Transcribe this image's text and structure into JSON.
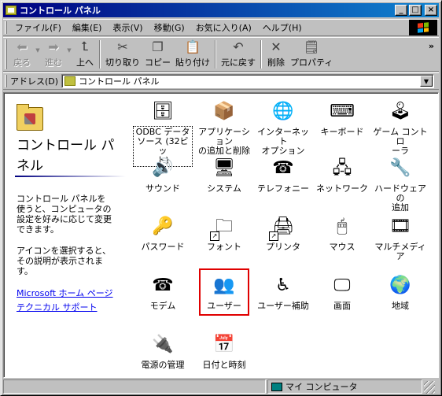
{
  "window": {
    "title": "コントロール パネル"
  },
  "titlebar_buttons": {
    "minimize": "_",
    "maximize": "□",
    "close": "×"
  },
  "menu": [
    "ファイル(F)",
    "編集(E)",
    "表示(V)",
    "移動(G)",
    "お気に入り(A)",
    "ヘルプ(H)"
  ],
  "toolbar": {
    "back": "戻る",
    "forward": "進む",
    "up": "上へ",
    "cut": "切り取り",
    "copy": "コピー",
    "paste": "貼り付け",
    "undo": "元に戻す",
    "delete": "削除",
    "properties": "プロパティ",
    "more": "»"
  },
  "address": {
    "label": "アドレス(D)",
    "value": "コントロール パネル"
  },
  "leftpane": {
    "title": "コントロール パネル",
    "description": "コントロール パネルを使うと、コンピュータの設定を好みに応じて変更できます。",
    "hint": "アイコンを選択すると、その説明が表示されます。",
    "links": [
      "Microsoft ホーム ページ",
      "テクニカル サポート"
    ]
  },
  "items": [
    {
      "label": "ODBC データ\nソース (32ビッ\nト)",
      "icon": "odbc-icon",
      "symbol": "🗄"
    },
    {
      "label": "アプリケーション\nの追加と削除",
      "icon": "add-remove-programs-icon",
      "symbol": "📦"
    },
    {
      "label": "インターネット\nオプション",
      "icon": "internet-options-icon",
      "symbol": "🌐"
    },
    {
      "label": "キーボード",
      "icon": "keyboard-icon",
      "symbol": "⌨"
    },
    {
      "label": "ゲーム コントロ\nーラ",
      "icon": "game-controller-icon",
      "symbol": "🕹"
    },
    {
      "label": "サウンド",
      "icon": "sound-icon",
      "symbol": "🔊"
    },
    {
      "label": "システム",
      "icon": "system-icon",
      "symbol": "🖥"
    },
    {
      "label": "テレフォニー",
      "icon": "telephony-icon",
      "symbol": "☎"
    },
    {
      "label": "ネットワーク",
      "icon": "network-icon",
      "symbol": "🖧"
    },
    {
      "label": "ハードウェアの\n追加",
      "icon": "add-hardware-icon",
      "symbol": "🔧"
    },
    {
      "label": "パスワード",
      "icon": "passwords-icon",
      "symbol": "🔑"
    },
    {
      "label": "フォント",
      "icon": "fonts-folder-icon",
      "symbol": "🗀"
    },
    {
      "label": "プリンタ",
      "icon": "printers-folder-icon",
      "symbol": "🖨"
    },
    {
      "label": "マウス",
      "icon": "mouse-icon",
      "symbol": "🖱"
    },
    {
      "label": "マルチメディア",
      "icon": "multimedia-icon",
      "symbol": "🎞"
    },
    {
      "label": "モデム",
      "icon": "modem-icon",
      "symbol": "☎"
    },
    {
      "label": "ユーザー",
      "icon": "users-icon",
      "symbol": "👥"
    },
    {
      "label": "ユーザー補助",
      "icon": "accessibility-icon",
      "symbol": "♿"
    },
    {
      "label": "画面",
      "icon": "display-icon",
      "symbol": "🖵"
    },
    {
      "label": "地域",
      "icon": "regional-settings-icon",
      "symbol": "🌍"
    },
    {
      "label": "電源の管理",
      "icon": "power-management-icon",
      "symbol": "🔌"
    },
    {
      "label": "日付と時刻",
      "icon": "date-time-icon",
      "symbol": "📅"
    }
  ],
  "statusbar": {
    "zone": "マイ コンピュータ"
  }
}
